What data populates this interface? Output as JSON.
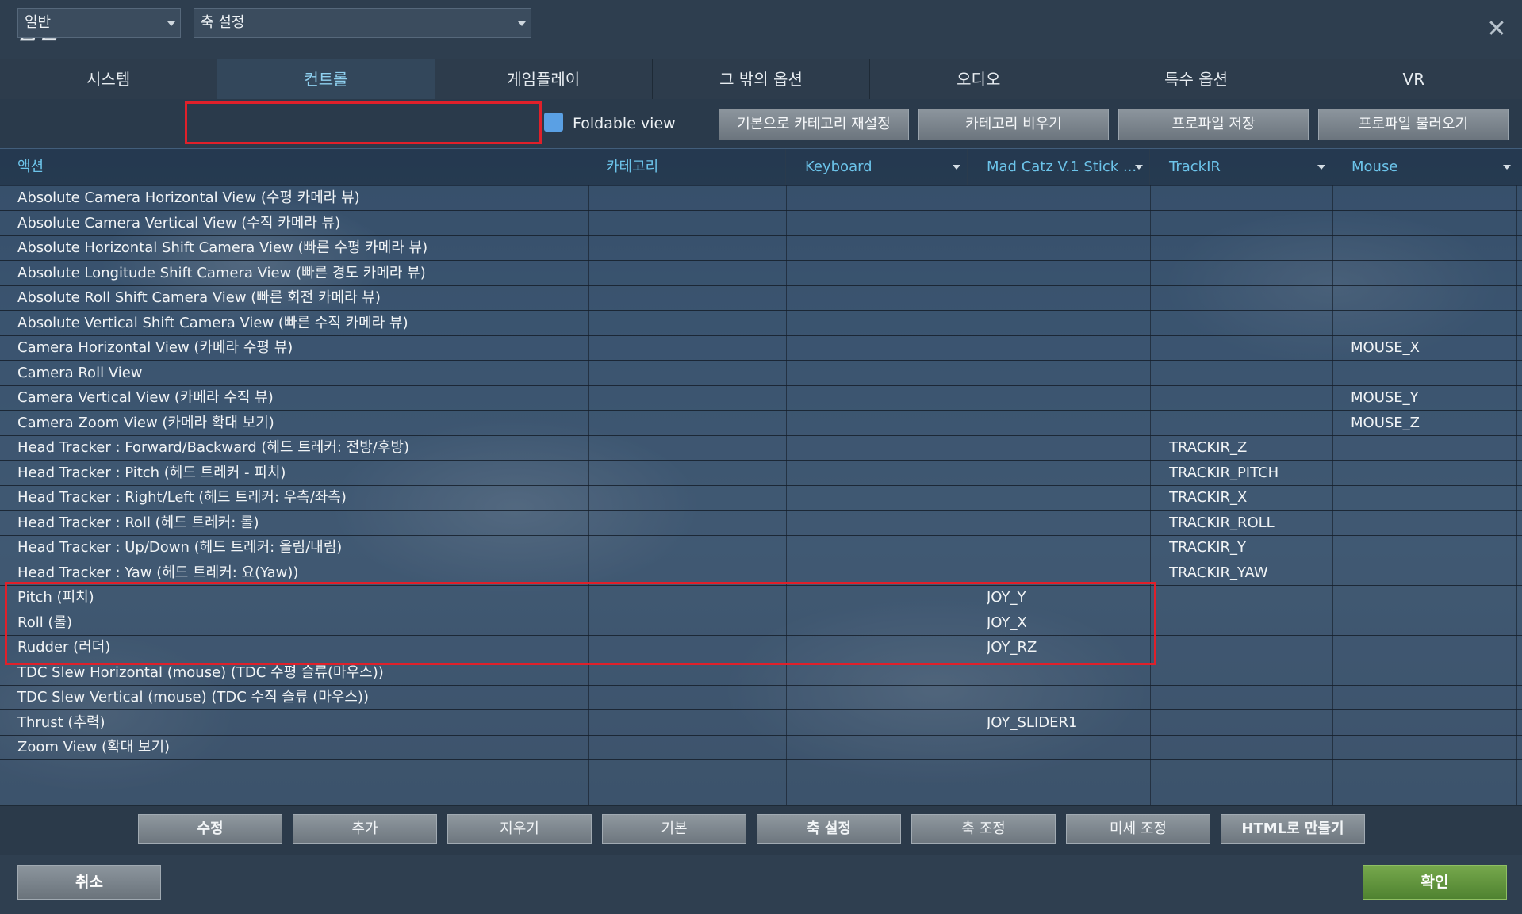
{
  "window": {
    "title": "옵션",
    "close_label": "✕"
  },
  "tabs": [
    {
      "label": "시스템"
    },
    {
      "label": "컨트롤"
    },
    {
      "label": "게임플레이"
    },
    {
      "label": "그 밖의 옵션"
    },
    {
      "label": "오디오"
    },
    {
      "label": "특수 옵션"
    },
    {
      "label": "VR"
    }
  ],
  "active_tab": "컨트롤",
  "toolbar": {
    "aircraft_select": "일반",
    "category_select": "축 설정",
    "foldable_view_label": "Foldable view",
    "foldable_view_checked": true,
    "buttons": [
      {
        "label": "기본으로 카테고리 재설정"
      },
      {
        "label": "카테고리 비우기"
      },
      {
        "label": "프로파일 저장"
      },
      {
        "label": "프로파일 불러오기"
      }
    ]
  },
  "table": {
    "columns": [
      {
        "label": "액션"
      },
      {
        "label": "카테고리"
      },
      {
        "label": "Keyboard"
      },
      {
        "label": "Mad Catz V.1 Stick ..."
      },
      {
        "label": "TrackIR"
      },
      {
        "label": "Mouse"
      }
    ],
    "rows": [
      {
        "action": "Absolute Camera Horizontal View (수평 카메라 뷰)",
        "category": "",
        "keyboard": "",
        "joystick": "",
        "trackir": "",
        "mouse": ""
      },
      {
        "action": "Absolute Camera Vertical View (수직 카메라 뷰)",
        "category": "",
        "keyboard": "",
        "joystick": "",
        "trackir": "",
        "mouse": ""
      },
      {
        "action": "Absolute Horizontal Shift Camera View (빠른 수평 카메라 뷰)",
        "category": "",
        "keyboard": "",
        "joystick": "",
        "trackir": "",
        "mouse": ""
      },
      {
        "action": "Absolute Longitude Shift Camera View (빠른 경도 카메라 뷰)",
        "category": "",
        "keyboard": "",
        "joystick": "",
        "trackir": "",
        "mouse": ""
      },
      {
        "action": "Absolute Roll Shift Camera View (빠른 회전 카메라 뷰)",
        "category": "",
        "keyboard": "",
        "joystick": "",
        "trackir": "",
        "mouse": ""
      },
      {
        "action": "Absolute Vertical Shift Camera View (빠른 수직 카메라 뷰)",
        "category": "",
        "keyboard": "",
        "joystick": "",
        "trackir": "",
        "mouse": ""
      },
      {
        "action": "Camera Horizontal View (카메라 수평 뷰)",
        "category": "",
        "keyboard": "",
        "joystick": "",
        "trackir": "",
        "mouse": "MOUSE_X"
      },
      {
        "action": "Camera Roll View",
        "category": "",
        "keyboard": "",
        "joystick": "",
        "trackir": "",
        "mouse": ""
      },
      {
        "action": "Camera Vertical View (카메라 수직 뷰)",
        "category": "",
        "keyboard": "",
        "joystick": "",
        "trackir": "",
        "mouse": "MOUSE_Y"
      },
      {
        "action": "Camera Zoom View (카메라 확대 보기)",
        "category": "",
        "keyboard": "",
        "joystick": "",
        "trackir": "",
        "mouse": "MOUSE_Z"
      },
      {
        "action": "Head Tracker : Forward/Backward (헤드 트레커: 전방/후방)",
        "category": "",
        "keyboard": "",
        "joystick": "",
        "trackir": "TRACKIR_Z",
        "mouse": ""
      },
      {
        "action": "Head Tracker : Pitch (헤드 트레커 - 피치)",
        "category": "",
        "keyboard": "",
        "joystick": "",
        "trackir": "TRACKIR_PITCH",
        "mouse": ""
      },
      {
        "action": "Head Tracker : Right/Left (헤드 트레커: 우측/좌측)",
        "category": "",
        "keyboard": "",
        "joystick": "",
        "trackir": "TRACKIR_X",
        "mouse": ""
      },
      {
        "action": "Head Tracker : Roll (헤드 트레커: 롤)",
        "category": "",
        "keyboard": "",
        "joystick": "",
        "trackir": "TRACKIR_ROLL",
        "mouse": ""
      },
      {
        "action": "Head Tracker : Up/Down (헤드 트레커: 올림/내림)",
        "category": "",
        "keyboard": "",
        "joystick": "",
        "trackir": "TRACKIR_Y",
        "mouse": ""
      },
      {
        "action": "Head Tracker : Yaw (헤드 트레커: 요(Yaw))",
        "category": "",
        "keyboard": "",
        "joystick": "",
        "trackir": "TRACKIR_YAW",
        "mouse": ""
      },
      {
        "action": "Pitch (피치)",
        "category": "",
        "keyboard": "",
        "joystick": "JOY_Y",
        "trackir": "",
        "mouse": ""
      },
      {
        "action": "Roll (롤)",
        "category": "",
        "keyboard": "",
        "joystick": "JOY_X",
        "trackir": "",
        "mouse": ""
      },
      {
        "action": "Rudder (러더)",
        "category": "",
        "keyboard": "",
        "joystick": "JOY_RZ",
        "trackir": "",
        "mouse": ""
      },
      {
        "action": "TDC Slew Horizontal (mouse) (TDC 수평 슬류(마우스))",
        "category": "",
        "keyboard": "",
        "joystick": "",
        "trackir": "",
        "mouse": ""
      },
      {
        "action": "TDC Slew Vertical (mouse) (TDC 수직 슬류 (마우스))",
        "category": "",
        "keyboard": "",
        "joystick": "",
        "trackir": "",
        "mouse": ""
      },
      {
        "action": "Thrust (추력)",
        "category": "",
        "keyboard": "",
        "joystick": "JOY_SLIDER1",
        "trackir": "",
        "mouse": ""
      },
      {
        "action": "Zoom View (확대 보기)",
        "category": "",
        "keyboard": "",
        "joystick": "",
        "trackir": "",
        "mouse": ""
      }
    ]
  },
  "bottom_buttons": [
    {
      "label": "수정"
    },
    {
      "label": "추가"
    },
    {
      "label": "지우기"
    },
    {
      "label": "기본"
    },
    {
      "label": "축 설정"
    },
    {
      "label": "축 조정"
    },
    {
      "label": "미세 조정"
    },
    {
      "label": "HTML로 만들기"
    }
  ],
  "footer": {
    "cancel_label": "취소",
    "ok_label": "확인"
  },
  "colors": {
    "accent": "#6cc4ea",
    "highlight": "#e0202a",
    "ok_button": "#5f9438"
  }
}
